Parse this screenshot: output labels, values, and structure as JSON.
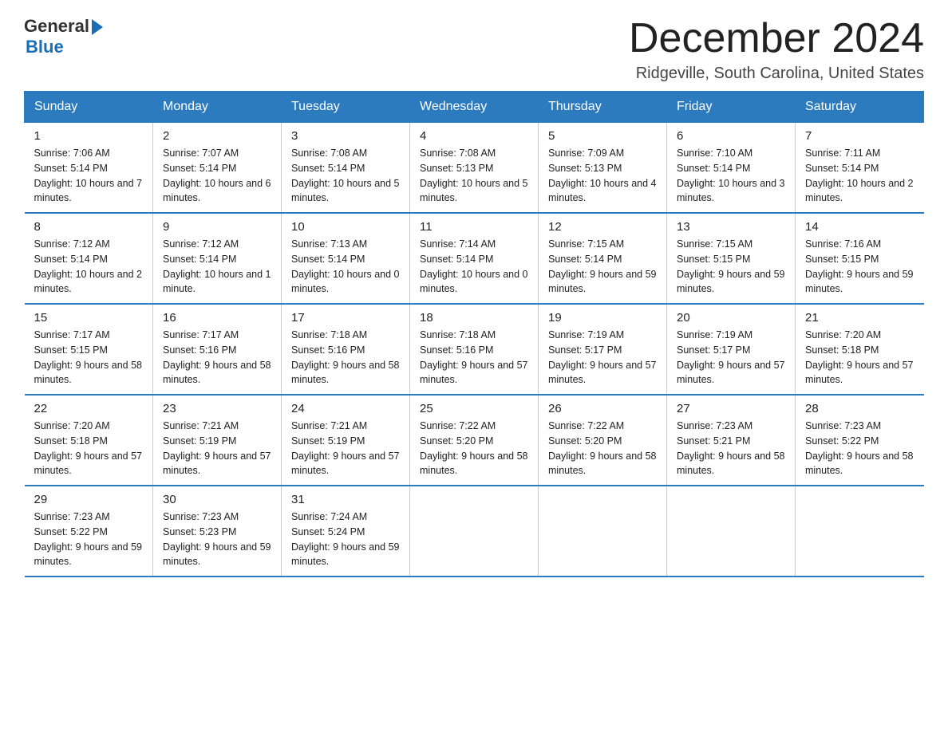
{
  "header": {
    "logo_general": "General",
    "logo_blue": "Blue",
    "month_title": "December 2024",
    "location": "Ridgeville, South Carolina, United States"
  },
  "days_of_week": [
    "Sunday",
    "Monday",
    "Tuesday",
    "Wednesday",
    "Thursday",
    "Friday",
    "Saturday"
  ],
  "weeks": [
    [
      {
        "day": "1",
        "sunrise": "7:06 AM",
        "sunset": "5:14 PM",
        "daylight": "10 hours and 7 minutes."
      },
      {
        "day": "2",
        "sunrise": "7:07 AM",
        "sunset": "5:14 PM",
        "daylight": "10 hours and 6 minutes."
      },
      {
        "day": "3",
        "sunrise": "7:08 AM",
        "sunset": "5:14 PM",
        "daylight": "10 hours and 5 minutes."
      },
      {
        "day": "4",
        "sunrise": "7:08 AM",
        "sunset": "5:13 PM",
        "daylight": "10 hours and 5 minutes."
      },
      {
        "day": "5",
        "sunrise": "7:09 AM",
        "sunset": "5:13 PM",
        "daylight": "10 hours and 4 minutes."
      },
      {
        "day": "6",
        "sunrise": "7:10 AM",
        "sunset": "5:14 PM",
        "daylight": "10 hours and 3 minutes."
      },
      {
        "day": "7",
        "sunrise": "7:11 AM",
        "sunset": "5:14 PM",
        "daylight": "10 hours and 2 minutes."
      }
    ],
    [
      {
        "day": "8",
        "sunrise": "7:12 AM",
        "sunset": "5:14 PM",
        "daylight": "10 hours and 2 minutes."
      },
      {
        "day": "9",
        "sunrise": "7:12 AM",
        "sunset": "5:14 PM",
        "daylight": "10 hours and 1 minute."
      },
      {
        "day": "10",
        "sunrise": "7:13 AM",
        "sunset": "5:14 PM",
        "daylight": "10 hours and 0 minutes."
      },
      {
        "day": "11",
        "sunrise": "7:14 AM",
        "sunset": "5:14 PM",
        "daylight": "10 hours and 0 minutes."
      },
      {
        "day": "12",
        "sunrise": "7:15 AM",
        "sunset": "5:14 PM",
        "daylight": "9 hours and 59 minutes."
      },
      {
        "day": "13",
        "sunrise": "7:15 AM",
        "sunset": "5:15 PM",
        "daylight": "9 hours and 59 minutes."
      },
      {
        "day": "14",
        "sunrise": "7:16 AM",
        "sunset": "5:15 PM",
        "daylight": "9 hours and 59 minutes."
      }
    ],
    [
      {
        "day": "15",
        "sunrise": "7:17 AM",
        "sunset": "5:15 PM",
        "daylight": "9 hours and 58 minutes."
      },
      {
        "day": "16",
        "sunrise": "7:17 AM",
        "sunset": "5:16 PM",
        "daylight": "9 hours and 58 minutes."
      },
      {
        "day": "17",
        "sunrise": "7:18 AM",
        "sunset": "5:16 PM",
        "daylight": "9 hours and 58 minutes."
      },
      {
        "day": "18",
        "sunrise": "7:18 AM",
        "sunset": "5:16 PM",
        "daylight": "9 hours and 57 minutes."
      },
      {
        "day": "19",
        "sunrise": "7:19 AM",
        "sunset": "5:17 PM",
        "daylight": "9 hours and 57 minutes."
      },
      {
        "day": "20",
        "sunrise": "7:19 AM",
        "sunset": "5:17 PM",
        "daylight": "9 hours and 57 minutes."
      },
      {
        "day": "21",
        "sunrise": "7:20 AM",
        "sunset": "5:18 PM",
        "daylight": "9 hours and 57 minutes."
      }
    ],
    [
      {
        "day": "22",
        "sunrise": "7:20 AM",
        "sunset": "5:18 PM",
        "daylight": "9 hours and 57 minutes."
      },
      {
        "day": "23",
        "sunrise": "7:21 AM",
        "sunset": "5:19 PM",
        "daylight": "9 hours and 57 minutes."
      },
      {
        "day": "24",
        "sunrise": "7:21 AM",
        "sunset": "5:19 PM",
        "daylight": "9 hours and 57 minutes."
      },
      {
        "day": "25",
        "sunrise": "7:22 AM",
        "sunset": "5:20 PM",
        "daylight": "9 hours and 58 minutes."
      },
      {
        "day": "26",
        "sunrise": "7:22 AM",
        "sunset": "5:20 PM",
        "daylight": "9 hours and 58 minutes."
      },
      {
        "day": "27",
        "sunrise": "7:23 AM",
        "sunset": "5:21 PM",
        "daylight": "9 hours and 58 minutes."
      },
      {
        "day": "28",
        "sunrise": "7:23 AM",
        "sunset": "5:22 PM",
        "daylight": "9 hours and 58 minutes."
      }
    ],
    [
      {
        "day": "29",
        "sunrise": "7:23 AM",
        "sunset": "5:22 PM",
        "daylight": "9 hours and 59 minutes."
      },
      {
        "day": "30",
        "sunrise": "7:23 AM",
        "sunset": "5:23 PM",
        "daylight": "9 hours and 59 minutes."
      },
      {
        "day": "31",
        "sunrise": "7:24 AM",
        "sunset": "5:24 PM",
        "daylight": "9 hours and 59 minutes."
      },
      null,
      null,
      null,
      null
    ]
  ]
}
